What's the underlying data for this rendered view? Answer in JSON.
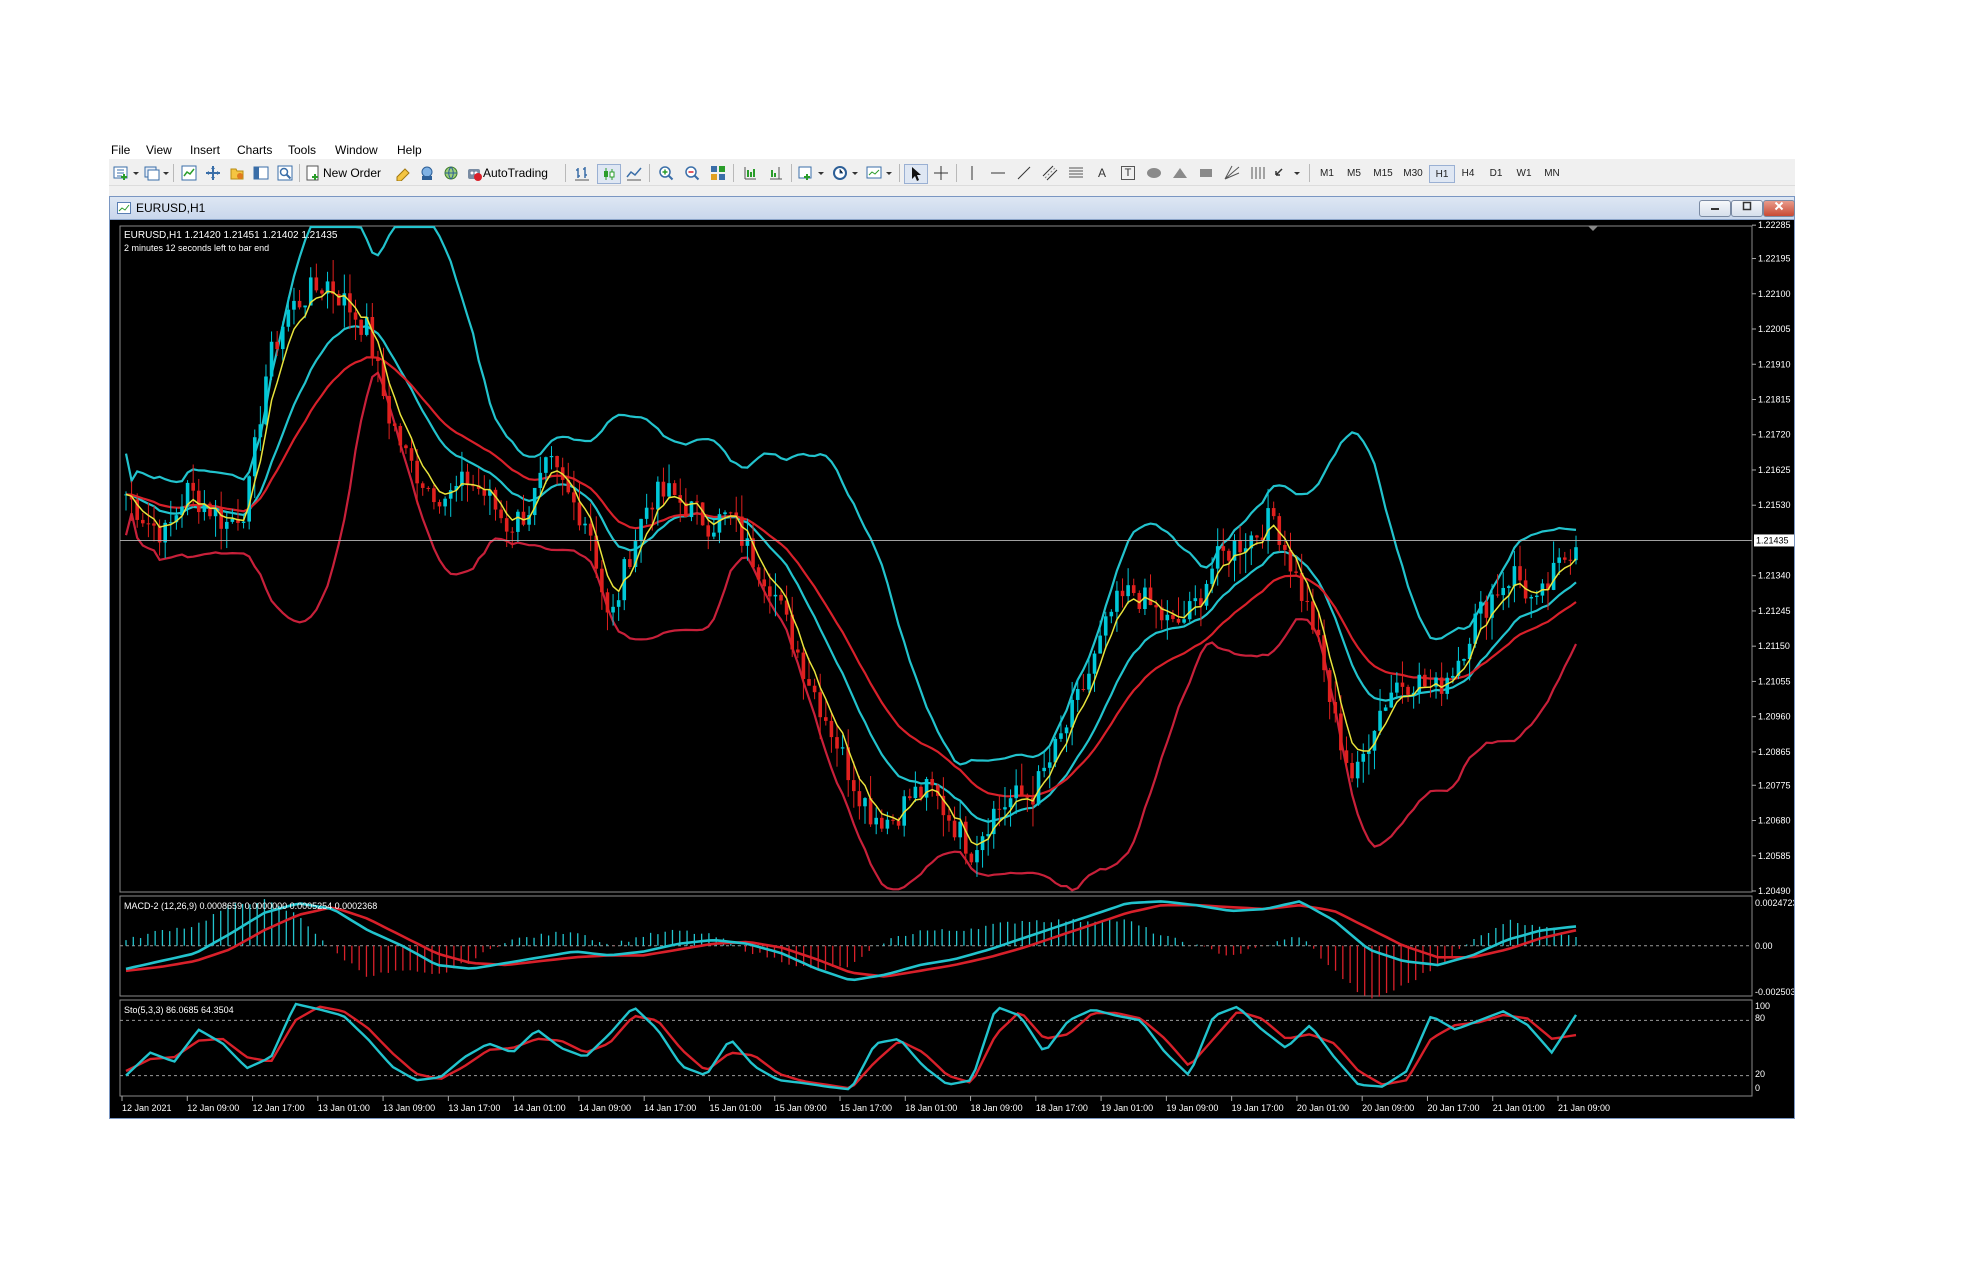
{
  "menu": [
    "File",
    "View",
    "Insert",
    "Charts",
    "Tools",
    "Window",
    "Help"
  ],
  "toolbar": {
    "new_order": "New Order",
    "autotrading": "AutoTrading",
    "text_tool": "A",
    "label_tool": "T",
    "timeframes": [
      "M1",
      "M5",
      "M15",
      "M30",
      "H1",
      "H4",
      "D1",
      "W1",
      "MN"
    ],
    "active_timeframe": "H1"
  },
  "window": {
    "title": "EURUSD,H1",
    "info_line": "EURUSD,H1  1.21420 1.21451 1.21402 1.21435",
    "countdown": "2 minutes 12 seconds left to bar end"
  },
  "colors": {
    "background": "#000000",
    "bull": "#00c8d8",
    "bear": "#e0201e",
    "cyan_line": "#22c3cd",
    "red_line": "#d8202a",
    "crimson_band": "#c8203a",
    "yellow_ma": "#e8e33c"
  },
  "chart_data": [
    {
      "type": "candlestick",
      "symbol": "EURUSD,H1",
      "current_price": "1.21435",
      "ylim": [
        1.2049,
        1.2228
      ],
      "y_ticks": [
        "1.22285",
        "1.22195",
        "1.22100",
        "1.22005",
        "1.21910",
        "1.21815",
        "1.21720",
        "1.21625",
        "1.21530",
        "1.21340",
        "1.21245",
        "1.21150",
        "1.21055",
        "1.20960",
        "1.20865",
        "1.20775",
        "1.20680",
        "1.20585",
        "1.20490"
      ],
      "x_labels": [
        "12 Jan 2021",
        "12 Jan 09:00",
        "12 Jan 17:00",
        "13 Jan 01:00",
        "13 Jan 09:00",
        "13 Jan 17:00",
        "14 Jan 01:00",
        "14 Jan 09:00",
        "14 Jan 17:00",
        "15 Jan 01:00",
        "15 Jan 09:00",
        "15 Jan 17:00",
        "18 Jan 01:00",
        "18 Jan 09:00",
        "18 Jan 17:00",
        "19 Jan 01:00",
        "19 Jan 09:00",
        "19 Jan 17:00",
        "20 Jan 01:00",
        "20 Jan 09:00",
        "20 Jan 17:00",
        "21 Jan 01:00",
        "21 Jan 09:00"
      ],
      "close_path": [
        1.2156,
        1.2149,
        1.2145,
        1.2157,
        1.2153,
        1.2148,
        1.2153,
        1.219,
        1.2205,
        1.221,
        1.2213,
        1.2207,
        1.22,
        1.2178,
        1.2165,
        1.2158,
        1.2155,
        1.216,
        1.2155,
        1.2147,
        1.2152,
        1.2164,
        1.2155,
        1.2148,
        1.212,
        1.214,
        1.2155,
        1.2156,
        1.2152,
        1.2148,
        1.215,
        1.214,
        1.2132,
        1.2118,
        1.2105,
        1.2093,
        1.208,
        1.207,
        1.2068,
        1.2075,
        1.2076,
        1.2068,
        1.206,
        1.207,
        1.2074,
        1.2075,
        1.2085,
        1.2097,
        1.211,
        1.2125,
        1.213,
        1.2125,
        1.212,
        1.2125,
        1.2137,
        1.2142,
        1.2145,
        1.215,
        1.2135,
        1.212,
        1.2095,
        1.2078,
        1.2095,
        1.2105,
        1.2106,
        1.2103,
        1.211,
        1.2122,
        1.213,
        1.2135,
        1.2125,
        1.2135,
        1.2144
      ],
      "series": [
        {
          "name": "Bollinger Bands (upper)",
          "color": "#22c3cd"
        },
        {
          "name": "Bollinger Bands (lower)",
          "color": "#c8203a"
        },
        {
          "name": "Moving Average",
          "color": "#e8e33c"
        }
      ]
    },
    {
      "type": "histogram",
      "title": "MACD-2 (12,26,9) 0.0008659 0.0000000 0.0005254 0.0002368",
      "y_ticks": [
        "0.0024723",
        "0.00",
        "-0.002503"
      ],
      "ylim": [
        -0.002503,
        0.0024723
      ],
      "values_main": [
        -0.0012,
        -0.0008,
        -0.0004,
        0.0006,
        0.0017,
        0.0022,
        0.0019,
        0.0008,
        0.0,
        -0.001,
        -0.0012,
        -0.0009,
        -0.0006,
        -0.0003,
        -0.0005,
        -0.0003,
        0.0001,
        0.0003,
        0.0001,
        -0.0004,
        -0.0012,
        -0.0018,
        -0.0015,
        -0.001,
        -0.0007,
        -0.0002,
        0.0004,
        0.001,
        0.0016,
        0.0022,
        0.0023,
        0.0021,
        0.0018,
        0.0019,
        0.0023,
        0.0013,
        -0.0002,
        -0.0008,
        -0.001,
        -0.0005,
        0.0003,
        0.0008,
        0.001
      ],
      "values_signal": [
        -0.0013,
        -0.0011,
        -0.0008,
        -0.0002,
        0.0008,
        0.0016,
        0.002,
        0.0014,
        0.0005,
        -0.0004,
        -0.0009,
        -0.001,
        -0.0008,
        -0.0006,
        -0.0005,
        -0.0005,
        -0.0002,
        0.0001,
        0.0002,
        -0.0001,
        -0.0007,
        -0.0014,
        -0.0016,
        -0.0013,
        -0.001,
        -0.0006,
        -0.0001,
        0.0005,
        0.0011,
        0.0017,
        0.0021,
        0.0021,
        0.002,
        0.0019,
        0.0021,
        0.0018,
        0.0009,
        0.0,
        -0.0006,
        -0.0006,
        -0.0002,
        0.0004,
        0.0008
      ]
    },
    {
      "type": "line",
      "title": "Sto(5,3,3) 86.0685 64.3504",
      "y_ticks": [
        "100",
        "80",
        "20",
        "0"
      ],
      "ylim": [
        0,
        100
      ],
      "levels": [
        80,
        20
      ],
      "k_values": [
        20,
        45,
        35,
        70,
        55,
        28,
        40,
        98,
        92,
        85,
        60,
        30,
        15,
        18,
        40,
        55,
        45,
        70,
        50,
        40,
        65,
        95,
        70,
        30,
        20,
        60,
        30,
        15,
        12,
        8,
        5,
        55,
        60,
        30,
        10,
        15,
        95,
        85,
        45,
        80,
        92,
        85,
        80,
        45,
        20,
        85,
        95,
        70,
        50,
        75,
        40,
        10,
        8,
        25,
        85,
        70,
        80,
        90,
        75,
        45,
        86
      ],
      "d_values": [
        25,
        38,
        40,
        58,
        60,
        40,
        35,
        80,
        95,
        90,
        72,
        45,
        22,
        16,
        30,
        48,
        50,
        60,
        58,
        45,
        55,
        85,
        80,
        48,
        25,
        45,
        42,
        22,
        14,
        10,
        6,
        35,
        58,
        45,
        20,
        12,
        65,
        90,
        60,
        65,
        88,
        88,
        82,
        60,
        30,
        60,
        90,
        82,
        60,
        65,
        55,
        25,
        10,
        15,
        60,
        75,
        78,
        86,
        82,
        60,
        64
      ]
    }
  ]
}
